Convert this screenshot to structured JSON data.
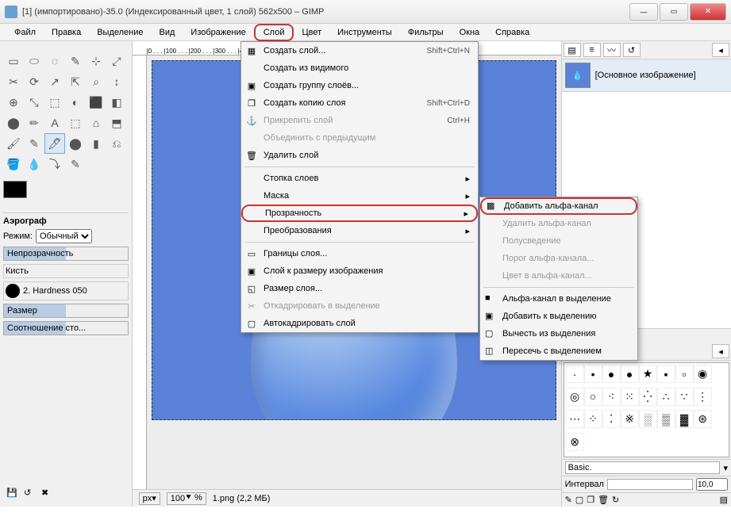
{
  "title": "[1] (импортировано)-35.0 (Индексированный цвет, 1 слой) 562x500 – GIMP",
  "menubar": [
    "Файл",
    "Правка",
    "Выделение",
    "Вид",
    "Изображение",
    "Слой",
    "Цвет",
    "Инструменты",
    "Фильтры",
    "Окна",
    "Справка"
  ],
  "active_menu_index": 5,
  "layer_menu": [
    {
      "label": "Создать слой...",
      "shortcut": "Shift+Ctrl+N",
      "icon": "▦"
    },
    {
      "label": "Создать из видимого"
    },
    {
      "label": "Создать группу слоёв...",
      "icon": "▣"
    },
    {
      "label": "Создать копию слоя",
      "shortcut": "Shift+Ctrl+D",
      "icon": "❐"
    },
    {
      "label": "Прикрепить слой",
      "shortcut": "Ctrl+H",
      "icon": "⚓",
      "disabled": true
    },
    {
      "label": "Объединить с предыдущим",
      "disabled": true
    },
    {
      "label": "Удалить слой",
      "icon": "🗑"
    },
    {
      "sep": true
    },
    {
      "label": "Стопка слоев",
      "arrow": true
    },
    {
      "label": "Маска",
      "arrow": true
    },
    {
      "label": "Прозрачность",
      "arrow": true,
      "highlight": true
    },
    {
      "label": "Преобразования",
      "arrow": true
    },
    {
      "sep": true
    },
    {
      "label": "Границы слоя...",
      "icon": "▭"
    },
    {
      "label": "Слой к размеру изображения",
      "icon": "▣"
    },
    {
      "label": "Размер слоя...",
      "icon": "◱"
    },
    {
      "label": "Откадрировать в выделение",
      "icon": "✂",
      "disabled": true
    },
    {
      "label": "Автокадрировать слой",
      "icon": "▢"
    }
  ],
  "transparency_submenu": [
    {
      "label": "Добавить альфа-канал",
      "highlight": true,
      "icon": "▩"
    },
    {
      "label": "Удалить альфа-канал",
      "disabled": true
    },
    {
      "label": "Полусведение",
      "disabled": true
    },
    {
      "label": "Порог альфа-канала...",
      "disabled": true
    },
    {
      "label": "Цвет в альфа-канал...",
      "disabled": true
    },
    {
      "sep": true
    },
    {
      "label": "Альфа-канал в выделение",
      "icon": "■"
    },
    {
      "label": "Добавить к выделению",
      "icon": "▣"
    },
    {
      "label": "Вычесть из выделения",
      "icon": "▢"
    },
    {
      "label": "Пересечь с выделением",
      "icon": "◫"
    }
  ],
  "tool_options": {
    "title": "Аэрограф",
    "mode_label": "Режим:",
    "mode_value": "Обычный",
    "opacity_label": "Непрозрачность",
    "brush_label": "Кисть",
    "brush_value": "2. Hardness 050",
    "size_label": "Размер",
    "ratio_label": "Соотношение сто..."
  },
  "status": {
    "unit": "px",
    "zoom": "100",
    "file": "1.png (2,2 МБ)"
  },
  "right": {
    "layer_label": "[Основное изображение]",
    "preset": "Basic.",
    "interval_label": "Интервал",
    "interval_value": "10,0"
  },
  "chart_data": null
}
